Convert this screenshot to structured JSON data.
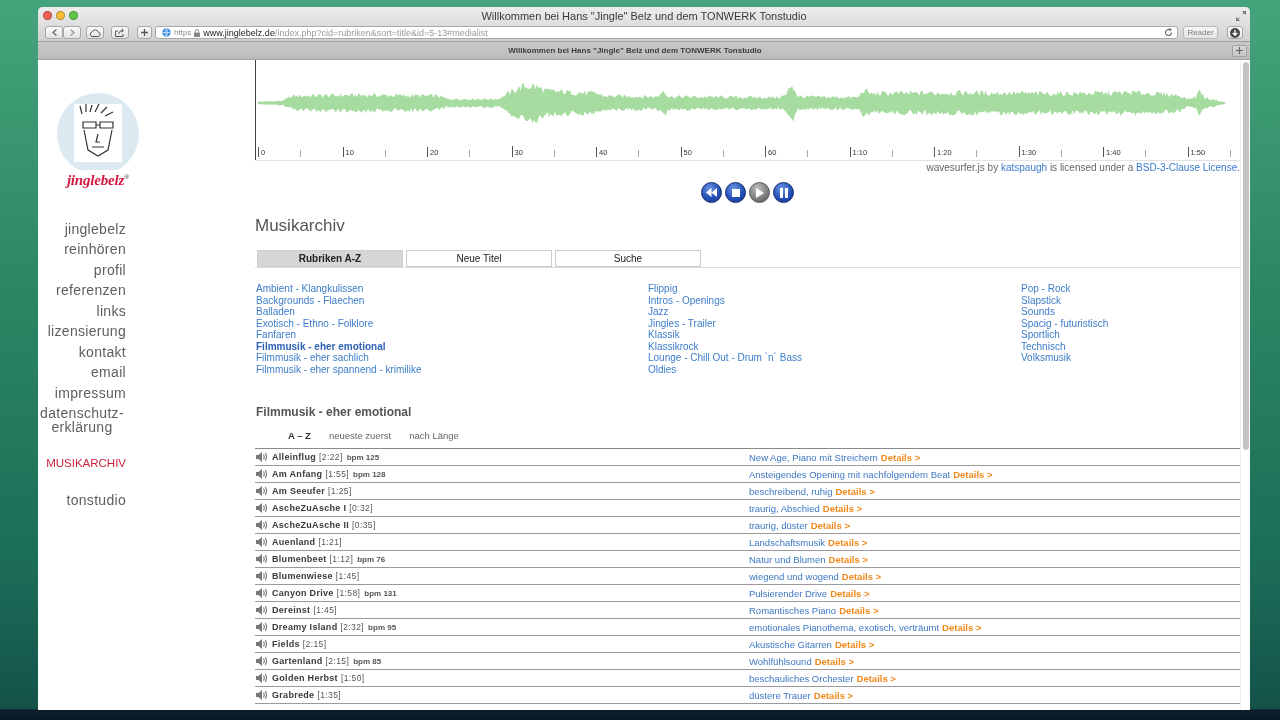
{
  "browser": {
    "window_title": "Willkommen bei Hans \"Jingle\" Belz und dem TONWERK Tonstudio",
    "address": {
      "scheme": "https",
      "host": "www.jinglebelz.de",
      "path": "/index.php?cid=rubriken&sort=title&id=5-13#medialist"
    },
    "reader": {
      "label": "Reader",
      "disabled": true
    },
    "tab_title": "Willkommen bei Hans \"Jingle\" Belz und dem TONWERK Tonstudio"
  },
  "sidebar": {
    "logo_text": "jinglebelz$^{®}$",
    "nav_groups": [
      {
        "items": [
          {
            "label": "jinglebelz",
            "selected": false
          },
          {
            "label": "reinhören",
            "selected": false
          },
          {
            "label": "profil",
            "selected": false
          },
          {
            "label": "referenzen",
            "selected": false
          },
          {
            "label": "links",
            "selected": false
          },
          {
            "label": "lizensierung",
            "selected": false
          },
          {
            "label": "kontakt",
            "selected": false
          },
          {
            "label": "email",
            "selected": false
          },
          {
            "label": "impressum",
            "selected": false
          },
          {
            "label": "datenschutz-erklärung",
            "selected": false
          }
        ]
      },
      {
        "items": [
          {
            "label": "MUSIKARCHIV",
            "selected": true
          }
        ]
      },
      {
        "items": [
          {
            "label": "tonstudio",
            "selected": false
          }
        ]
      }
    ]
  },
  "waveform": {
    "time_labels": [
      "0",
      "10",
      "20",
      "30",
      "40",
      "50",
      "60",
      "1:10",
      "1:20",
      "1:30",
      "1:40",
      "1:50"
    ]
  },
  "credit": {
    "parts": [
      {
        "kind": "text",
        "text": "wavesurfer.js by"
      },
      {
        "kind": "link",
        "text": "katspaugh"
      },
      {
        "kind": "text",
        "text": "is licensed under a"
      },
      {
        "kind": "link",
        "text": "BSD-3-Clause License."
      }
    ]
  },
  "player": {
    "buttons": [
      {
        "kind": "rewind",
        "disabled": false
      },
      {
        "kind": "stop",
        "disabled": false
      },
      {
        "kind": "play",
        "disabled": true
      },
      {
        "kind": "pause",
        "disabled": false
      }
    ]
  },
  "heading": "Musikarchiv",
  "archive_tabs": [
    {
      "label": "Rubriken A-Z",
      "selected": true
    },
    {
      "label": "Neue Titel",
      "selected": false
    },
    {
      "label": "Suche",
      "selected": false
    }
  ],
  "categories": {
    "columns": [
      {
        "items": [
          {
            "label": "Ambient - Klangkulissen",
            "selected": false
          },
          {
            "label": "Backgrounds - Flaechen",
            "selected": false
          },
          {
            "label": "Balladen",
            "selected": false
          },
          {
            "label": "Exotisch - Ethno - Folklore",
            "selected": false
          },
          {
            "label": "Fanfaren",
            "selected": false
          },
          {
            "label": "Filmmusik - eher emotional",
            "selected": true
          },
          {
            "label": "Filmmusik - eher sachlich",
            "selected": false
          },
          {
            "label": "Filmmusik - eher spannend - krimilike",
            "selected": false
          }
        ]
      },
      {
        "items": [
          {
            "label": "Flippig",
            "selected": false
          },
          {
            "label": "Intros - Openings",
            "selected": false
          },
          {
            "label": "Jazz",
            "selected": false
          },
          {
            "label": "Jingles - Trailer",
            "selected": false
          },
          {
            "label": "Klassik",
            "selected": false
          },
          {
            "label": "Klassikrock",
            "selected": false
          },
          {
            "label": "Lounge - Chill Out - Drum `n´ Bass",
            "selected": false
          },
          {
            "label": "Oldies",
            "selected": false
          }
        ]
      },
      {
        "items": [
          {
            "label": "Pop - Rock",
            "selected": false
          },
          {
            "label": "Slapstick",
            "selected": false
          },
          {
            "label": "Sounds",
            "selected": false
          },
          {
            "label": "Spacig - futuristisch",
            "selected": false
          },
          {
            "label": "Sportlich",
            "selected": false
          },
          {
            "label": "Technisch",
            "selected": false
          },
          {
            "label": "Volksmusik",
            "selected": false
          }
        ]
      }
    ]
  },
  "subheading": "Filmmusik - eher emotional",
  "sort_options": [
    {
      "label": "A – Z",
      "selected": true
    },
    {
      "label": "neueste zuerst",
      "selected": false
    },
    {
      "label": "nach Länge",
      "selected": false
    }
  ],
  "tracks": [
    {
      "title": "Alleinflug",
      "duration": "[2:22]",
      "bpm": "bpm 125",
      "description": "New Age, Piano mit Streichern",
      "details": "Details >"
    },
    {
      "title": "Am Anfang",
      "duration": "[1:55]",
      "bpm": "bpm 128",
      "description": "Ansteigendes Opening mit nachfolgendem Beat",
      "details": "Details >"
    },
    {
      "title": "Am Seeufer",
      "duration": "[1:25]",
      "description": "beschreibend, ruhig",
      "details": "Details >"
    },
    {
      "title": "AscheZuAsche I",
      "duration": "[0:32]",
      "description": "traurig, Abschied",
      "details": "Details >"
    },
    {
      "title": "AscheZuAsche II",
      "duration": "[0:35]",
      "description": "traurig, düster",
      "details": "Details >"
    },
    {
      "title": "Auenland",
      "duration": "[1:21]",
      "description": "Landschaftsmusik",
      "details": "Details >"
    },
    {
      "title": "Blumenbeet",
      "duration": "[1:12]",
      "bpm": "bpm 76",
      "description": "Natur und Blumen",
      "details": "Details >"
    },
    {
      "title": "Blumenwiese",
      "duration": "[1:45]",
      "description": "wiegend und wogend",
      "details": "Details >"
    },
    {
      "title": "Canyon Drive",
      "duration": "[1:58]",
      "bpm": "bpm 131",
      "description": "Pulsierender Drive",
      "details": "Details >"
    },
    {
      "title": "Dereinst",
      "duration": "[1:45]",
      "description": "Romantisches Piano",
      "details": "Details >"
    },
    {
      "title": "Dreamy Island",
      "duration": "[2:32]",
      "bpm": "bpm 95",
      "description": "emotionales Pianothema, exotisch, verträumt",
      "details": "Details >"
    },
    {
      "title": "Fields",
      "duration": "[2:15]",
      "description": "Akustische Gitarren",
      "details": "Details >"
    },
    {
      "title": "Gartenland",
      "duration": "[2:15]",
      "bpm": "bpm 85",
      "description": "Wohlfühlsound",
      "details": "Details >"
    },
    {
      "title": "Golden Herbst",
      "duration": "[1:50]",
      "description": "beschauliches Orchester",
      "details": "Details >"
    },
    {
      "title": "Grabrede",
      "duration": "[1:35]",
      "description": "düstere Trauer",
      "details": "Details >"
    }
  ]
}
